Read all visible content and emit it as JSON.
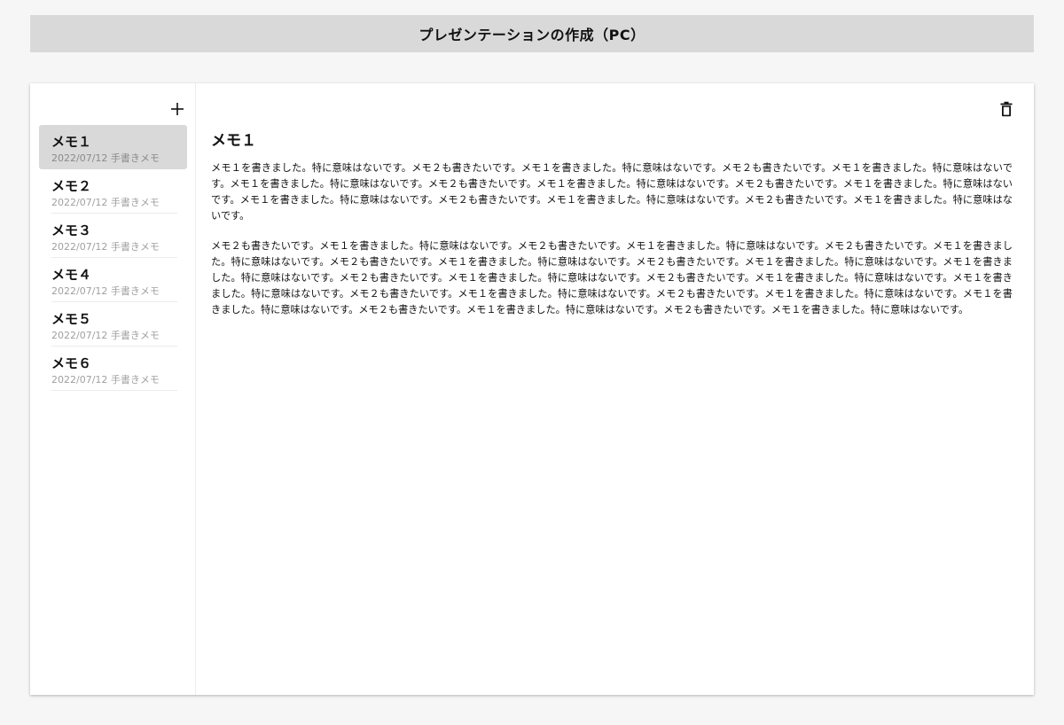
{
  "header": {
    "title": "プレゼンテーションの作成（PC）"
  },
  "sidebar": {
    "add_icon": "plus-icon",
    "items": [
      {
        "title": "メモ１",
        "meta": "2022/07/12 手書きメモ",
        "selected": true
      },
      {
        "title": "メモ２",
        "meta": "2022/07/12 手書きメモ",
        "selected": false
      },
      {
        "title": "メモ３",
        "meta": "2022/07/12 手書きメモ",
        "selected": false
      },
      {
        "title": "メモ４",
        "meta": "2022/07/12 手書きメモ",
        "selected": false
      },
      {
        "title": "メモ５",
        "meta": "2022/07/12 手書きメモ",
        "selected": false
      },
      {
        "title": "メモ６",
        "meta": "2022/07/12 手書きメモ",
        "selected": false
      }
    ]
  },
  "main": {
    "delete_icon": "trash-icon",
    "heading": "メモ１",
    "paragraphs": [
      "メモ１を書きました。特に意味はないです。メモ２も書きたいです。メモ１を書きました。特に意味はないです。メモ２も書きたいです。メモ１を書きました。特に意味はないです。メモ１を書きました。特に意味はないです。メモ２も書きたいです。メモ１を書きました。特に意味はないです。メモ２も書きたいです。メモ１を書きました。特に意味はないです。メモ１を書きました。特に意味はないです。メモ２も書きたいです。メモ１を書きました。特に意味はないです。メモ２も書きたいです。メモ１を書きました。特に意味はないです。",
      "メモ２も書きたいです。メモ１を書きました。特に意味はないです。メモ２も書きたいです。メモ１を書きました。特に意味はないです。メモ２も書きたいです。メモ１を書きました。特に意味はないです。メモ２も書きたいです。メモ１を書きました。特に意味はないです。メモ２も書きたいです。メモ１を書きました。特に意味はないです。メモ１を書きました。特に意味はないです。メモ２も書きたいです。メモ１を書きました。特に意味はないです。メモ２も書きたいです。メモ１を書きました。特に意味はないです。メモ１を書きました。特に意味はないです。メモ２も書きたいです。メモ１を書きました。特に意味はないです。メモ２も書きたいです。メモ１を書きました。特に意味はないです。メモ１を書きました。特に意味はないです。メモ２も書きたいです。メモ１を書きました。特に意味はないです。メモ２も書きたいです。メモ１を書きました。特に意味はないです。"
    ]
  },
  "colors": {
    "header_bg": "#d9d9d9",
    "page_bg": "#f6f6f6",
    "selected_bg": "#d9d9d9",
    "meta_text": "#a0a0a0"
  }
}
